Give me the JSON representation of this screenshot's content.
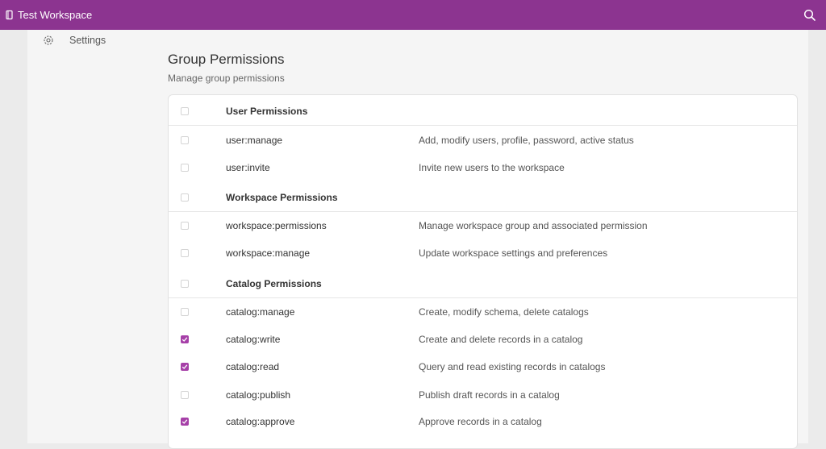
{
  "header": {
    "workspace_name": "Test Workspace",
    "brand_icon": "book-icon",
    "search_icon": "search-icon",
    "accent": "#8c3490"
  },
  "sidebar": {
    "settings_label": "Settings",
    "settings_icon": "gear-icon"
  },
  "page": {
    "title": "Group Permissions",
    "subtitle": "Manage group permissions"
  },
  "permissions": {
    "user_group": {
      "label": "User Permissions",
      "checked": false
    },
    "user_manage": {
      "name": "user:manage",
      "description": "Add, modify users, profile, password, active status",
      "checked": false
    },
    "user_invite": {
      "name": "user:invite",
      "description": "Invite new users to the workspace",
      "checked": false
    },
    "workspace_group": {
      "label": "Workspace Permissions",
      "checked": false
    },
    "workspace_permissions": {
      "name": "workspace:permissions",
      "description": "Manage workspace group and associated permission",
      "checked": false
    },
    "workspace_manage": {
      "name": "workspace:manage",
      "description": "Update workspace settings and preferences",
      "checked": false
    },
    "catalog_group": {
      "label": "Catalog Permissions",
      "checked": false
    },
    "catalog_manage": {
      "name": "catalog:manage",
      "description": "Create, modify schema, delete catalogs",
      "checked": false
    },
    "catalog_write": {
      "name": "catalog:write",
      "description": "Create and delete records in a catalog",
      "checked": true
    },
    "catalog_read": {
      "name": "catalog:read",
      "description": "Query and read existing records in catalogs",
      "checked": true
    },
    "catalog_publish": {
      "name": "catalog:publish",
      "description": "Publish draft records in a catalog",
      "checked": false
    },
    "catalog_approve": {
      "name": "catalog:approve",
      "description": "Approve records in a catalog",
      "checked": true
    }
  },
  "colors": {
    "checkbox_checked": "#a640a8"
  }
}
